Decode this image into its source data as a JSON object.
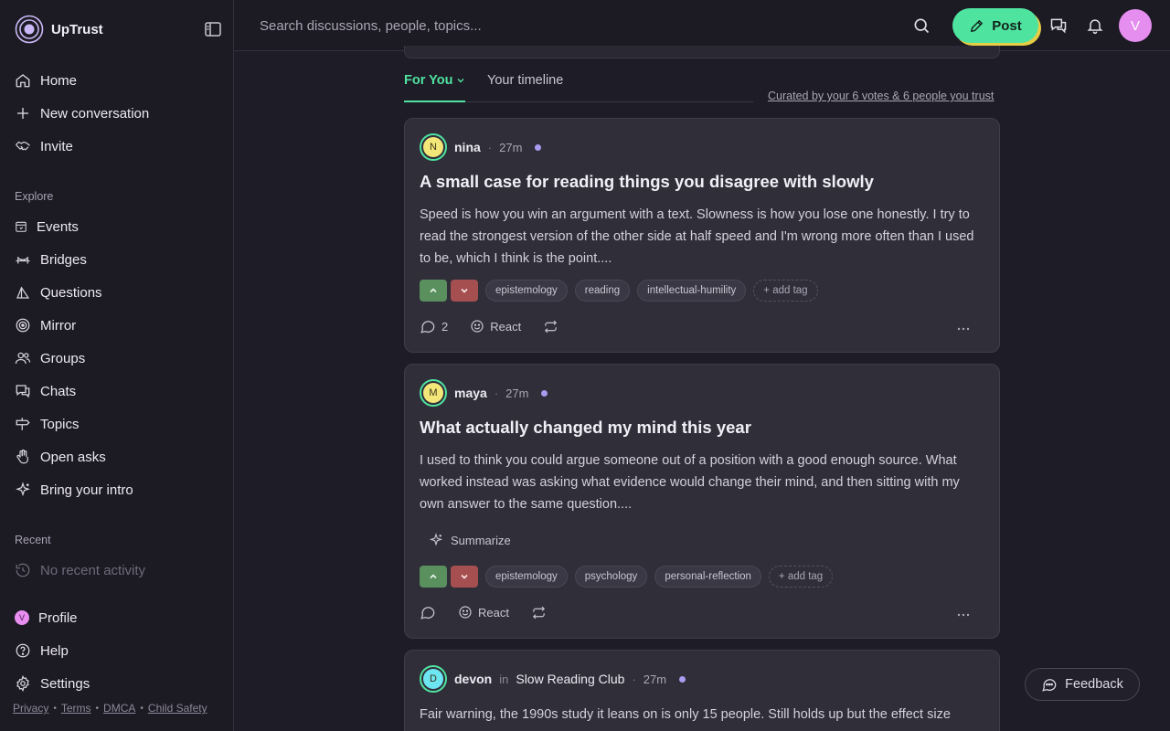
{
  "app": {
    "name": "UpTrust",
    "user_initial": "V"
  },
  "sidebar": {
    "primary": [
      {
        "label": "Home",
        "icon": "home-icon"
      },
      {
        "label": "New conversation",
        "icon": "plus-icon"
      },
      {
        "label": "Invite",
        "icon": "handshake-icon"
      }
    ],
    "explore_label": "Explore",
    "explore": [
      {
        "label": "Events",
        "icon": "calendar-icon"
      },
      {
        "label": "Bridges",
        "icon": "bridge-icon"
      },
      {
        "label": "Questions",
        "icon": "questions-icon"
      },
      {
        "label": "Mirror",
        "icon": "target-icon"
      },
      {
        "label": "Groups",
        "icon": "users-icon"
      },
      {
        "label": "Chats",
        "icon": "chat-icon"
      },
      {
        "label": "Topics",
        "icon": "signpost-icon"
      },
      {
        "label": "Open asks",
        "icon": "hand-icon"
      },
      {
        "label": "Bring your intro",
        "icon": "sparkle-icon"
      }
    ],
    "recent_label": "Recent",
    "recent_empty": "No recent activity",
    "bottom": [
      {
        "label": "Profile",
        "icon": "profile-avatar-icon",
        "initial": "V"
      },
      {
        "label": "Help",
        "icon": "help-icon"
      },
      {
        "label": "Settings",
        "icon": "gear-icon"
      }
    ],
    "footer_links": [
      "Privacy",
      "Terms",
      "DMCA",
      "Child Safety"
    ],
    "footer_separator": "•"
  },
  "topbar": {
    "search_placeholder": "Search discussions, people, topics...",
    "post_label": "Post"
  },
  "feed": {
    "tabs": [
      {
        "label": "For You"
      },
      {
        "label": "Your timeline"
      }
    ],
    "curated_text": "Curated by your 6 votes & 6 people you trust",
    "posts": [
      {
        "author": "nina",
        "initial": "N",
        "time": "27m",
        "group": "",
        "title": "A small case for reading things you disagree with slowly",
        "body": "Speed is how you win an argument with a text. Slowness is how you lose one honestly. I try to read the strongest version of the other side at half speed and I'm wrong more often than I used to be, which I think is the point....",
        "tags": [
          "epistemology",
          "reading",
          "intellectual-humility"
        ],
        "add_tag": "+ add tag",
        "comments": "2",
        "react": "React",
        "summarize": ""
      },
      {
        "author": "maya",
        "initial": "M",
        "time": "27m",
        "group": "",
        "title": "What actually changed my mind this year",
        "body": "I used to think you could argue someone out of a position with a good enough source. What worked instead was asking what evidence would change their mind, and then sitting with my own answer to the same question....",
        "tags": [
          "epistemology",
          "psychology",
          "personal-reflection"
        ],
        "add_tag": "+ add tag",
        "comments": "",
        "react": "React",
        "summarize": "Summarize"
      },
      {
        "author": "devon",
        "initial": "D",
        "time": "27m",
        "in_word": "in",
        "group": "Slow Reading Club",
        "title": "",
        "body": "Fair warning, the 1990s study it leans on is only 15 people. Still holds up but the effect size"
      }
    ]
  },
  "feedback_label": "Feedback",
  "colors": {
    "accent": "#4fe3a0",
    "accent_shadow": "#e6ce45",
    "background": "#1e1c26",
    "card": "#302e39",
    "upvote": "#5a8f5e",
    "downvote": "#a64f50",
    "unread_dot": "#a99cf0"
  }
}
